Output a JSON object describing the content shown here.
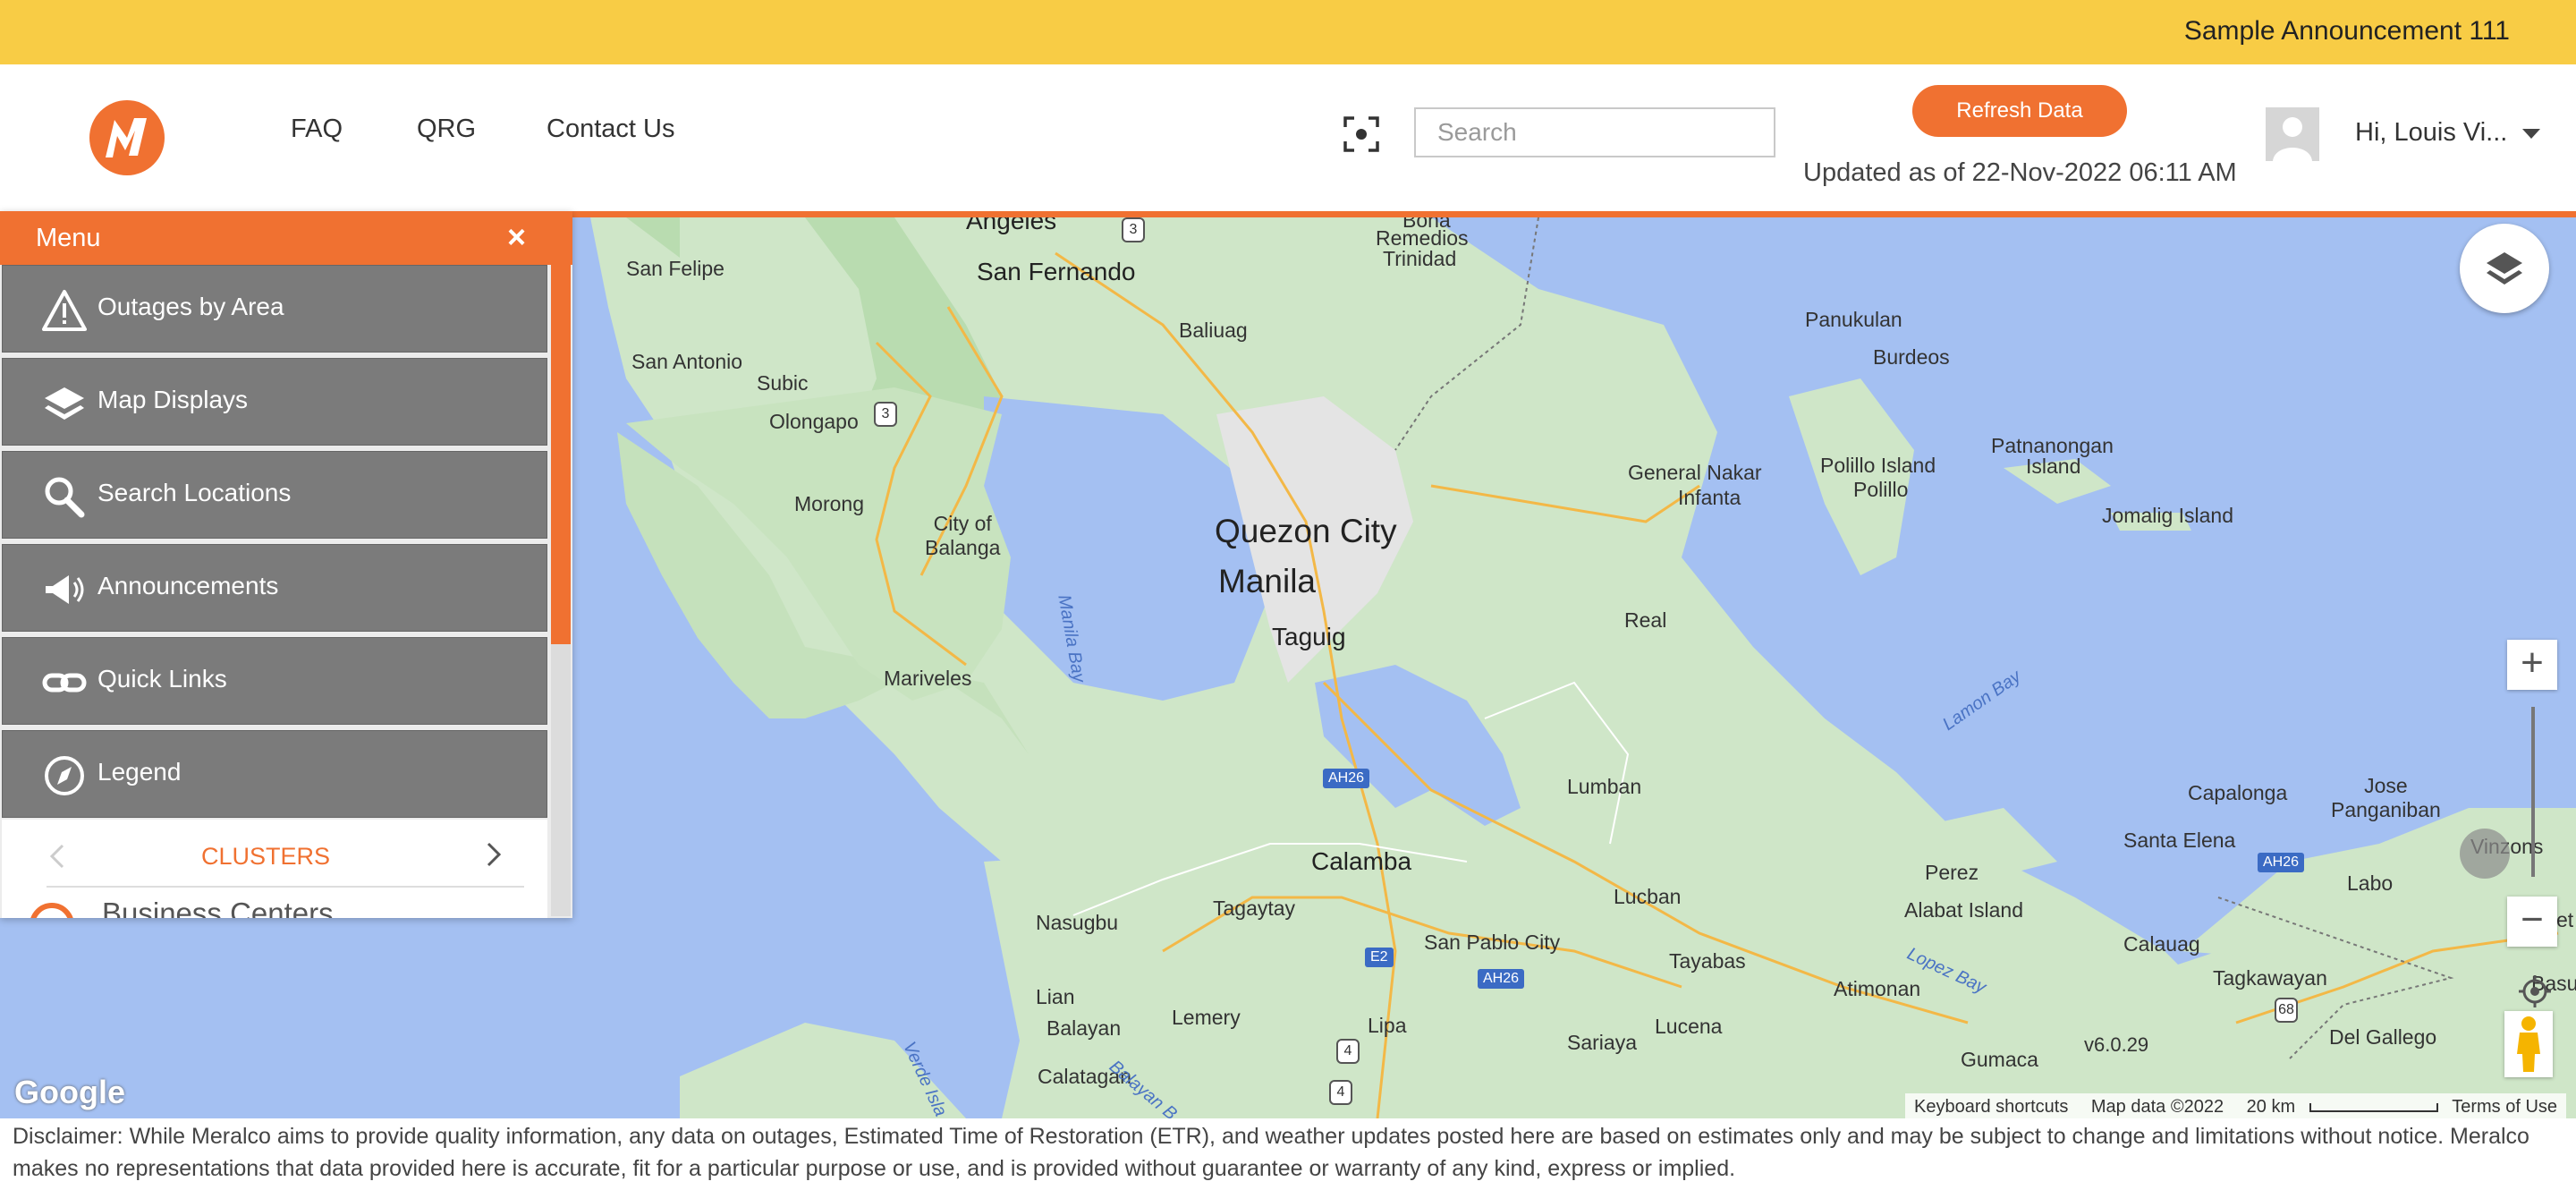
{
  "announcement": "Sample Announcement 111",
  "nav": {
    "faq": "FAQ",
    "qrg": "QRG",
    "contact": "Contact Us"
  },
  "search": {
    "placeholder": "Search"
  },
  "refresh_label": "Refresh Data",
  "updated_text": "Updated as of 22-Nov-2022 06:11 AM",
  "user_greeting": "Hi, Louis Vi...",
  "colors": {
    "brand": "#f07131",
    "announcement_bg": "#f8cc45",
    "menu_item_bg": "#7b7b7b",
    "water": "#a4c0f2",
    "land": "#cfe6c8"
  },
  "menu": {
    "title": "Menu",
    "close": "×",
    "items": [
      {
        "label": "Outages by Area",
        "icon": "warning-icon"
      },
      {
        "label": "Map Displays",
        "icon": "layers-icon"
      },
      {
        "label": "Search Locations",
        "icon": "search-icon"
      },
      {
        "label": "Announcements",
        "icon": "megaphone-icon"
      },
      {
        "label": "Quick Links",
        "icon": "link-icon"
      },
      {
        "label": "Legend",
        "icon": "compass-icon"
      }
    ],
    "clusters_label": "CLUSTERS",
    "cluster_first": "Business Centers"
  },
  "map": {
    "places": {
      "angeles": "Angeles",
      "san_fernando": "San Fernando",
      "san_felipe": "San Felipe",
      "bona": "Bona",
      "remedios": "Remedios",
      "trinidad": "Trinidad",
      "baliuag": "Baliuag",
      "san_antonio": "San Antonio",
      "subic": "Subic",
      "olongapo": "Olongapo",
      "morong": "Morong",
      "city_of_balanga": "City of\nBalanga",
      "mariveles": "Mariveles",
      "quezon_city": "Quezon City",
      "manila": "Manila",
      "taguig": "Taguig",
      "general_nakar": "General Nakar",
      "infanta": "Infanta",
      "panukulan": "Panukulan",
      "burdeos": "Burdeos",
      "polillo_island": "Polillo Island",
      "polillo": "Polillo",
      "patnanongan": "Patnanongan",
      "island": "Island",
      "jomalig": "Jomalig Island",
      "real": "Real",
      "lumban": "Lumban",
      "calamba": "Calamba",
      "nasugbu": "Nasugbu",
      "tagaytay": "Tagaytay",
      "lucban": "Lucban",
      "san_pablo": "San Pablo City",
      "tayabas": "Tayabas",
      "perez": "Perez",
      "alabat": "Alabat Island",
      "atimonan": "Atimonan",
      "lucena": "Lucena",
      "sariaya": "Sariaya",
      "lian": "Lian",
      "balayan": "Balayan",
      "lemery": "Lemery",
      "lipa": "Lipa",
      "calatagan": "Calatagan",
      "gumaca": "Gumaca",
      "capalonga": "Capalonga",
      "jose_panganiban": "Jose\nPanganiban",
      "santa_elena": "Santa Elena",
      "labo": "Labo",
      "vinzons": "Vinzons",
      "calauag": "Calauag",
      "tagkawayan": "Tagkawayan",
      "del_gallego": "Del Gallego",
      "basud": "Basu",
      "et": "et"
    },
    "water": {
      "manila_bay": "Manila Bay",
      "lamon_bay": "Lamon Bay",
      "lopez_bay": "Lopez Bay",
      "verde": "Verde Isla",
      "balayan_bay": "Balayan B"
    },
    "shields": {
      "r3a": "3",
      "r3b": "3",
      "ah26a": "AH26",
      "ah26b": "AH26",
      "ah26c": "AH26",
      "e2": "E2",
      "r4a": "4",
      "r4b": "4",
      "r68": "68"
    },
    "version": "v6.0.29",
    "google": "Google",
    "attribution": {
      "shortcuts": "Keyboard shortcuts",
      "data": "Map data ©2022",
      "scale": "20 km",
      "terms": "Terms of Use"
    },
    "zoom_in": "+",
    "zoom_out": "−"
  },
  "disclaimer": "Disclaimer: While Meralco aims to provide quality information, any data on outages, Estimated Time of Restoration (ETR), and weather updates posted here are based on estimates only and may be subject to change and limitations without notice. Meralco makes no representations that data provided here is accurate, fit for a particular purpose or use, and is provided without guarantee or warranty of any kind, express or implied."
}
